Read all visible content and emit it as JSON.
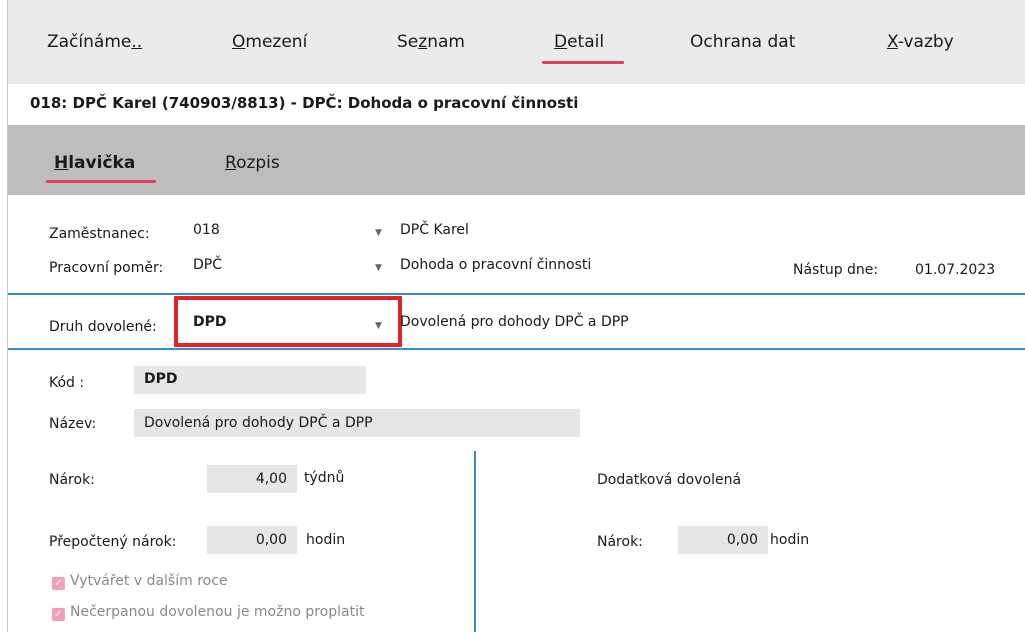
{
  "menu": {
    "items": [
      {
        "pre": "Začínáme",
        "u": "..",
        "post": ""
      },
      {
        "pre": "",
        "u": "O",
        "post": "mezení"
      },
      {
        "pre": "Se",
        "u": "z",
        "post": "nam"
      },
      {
        "pre": "",
        "u": "D",
        "post": "etail"
      },
      {
        "pre": "Ochrana dat",
        "u": "",
        "post": ""
      },
      {
        "pre": "",
        "u": "X",
        "post": "-vazby"
      }
    ],
    "active": "Detail"
  },
  "record_title": "018: DPČ Karel (740903/8813) - DPČ: Dohoda o pracovní činnosti",
  "subtabs": {
    "items": [
      {
        "pre": "",
        "u": "H",
        "post": "lavička"
      },
      {
        "pre": "",
        "u": "R",
        "post": "ozpis"
      }
    ],
    "active": "Hlavička"
  },
  "form": {
    "employee_label": "Zaměstnanec:",
    "employee_code": "018",
    "employee_name": "DPČ Karel",
    "relation_label": "Pracovní poměr:",
    "relation_code": "DPČ",
    "relation_name": "Dohoda o pracovní činnosti",
    "start_label": "Nástup dne:",
    "start_date": "01.07.2023",
    "leave_type_label": "Druh dovolené:",
    "leave_type_code": "DPD",
    "leave_type_name": "Dovolená pro dohody DPČ a DPP"
  },
  "detail": {
    "code_label": "Kód :",
    "code_value": "DPD",
    "name_label": "Název:",
    "name_value": "Dovolená pro dohody DPČ a DPP",
    "claim_label": "Nárok:",
    "claim_value": "4,00",
    "claim_unit": "týdnů",
    "recalc_label": "Přepočtený nárok:",
    "recalc_value": "0,00",
    "recalc_unit": "hodin",
    "extra_title": "Dodatková dovolená",
    "extra_claim_label": "Nárok:",
    "extra_claim_value": "0,00",
    "extra_claim_unit": "hodin",
    "checkbox_1": "Vytvářet v dalším roce",
    "checkbox_2": "Nečerpanou dovolenou je možno proplatit"
  },
  "colors": {
    "accent": "#e0415f",
    "highlight": "#e0232b",
    "divider": "#3a8fc4"
  }
}
